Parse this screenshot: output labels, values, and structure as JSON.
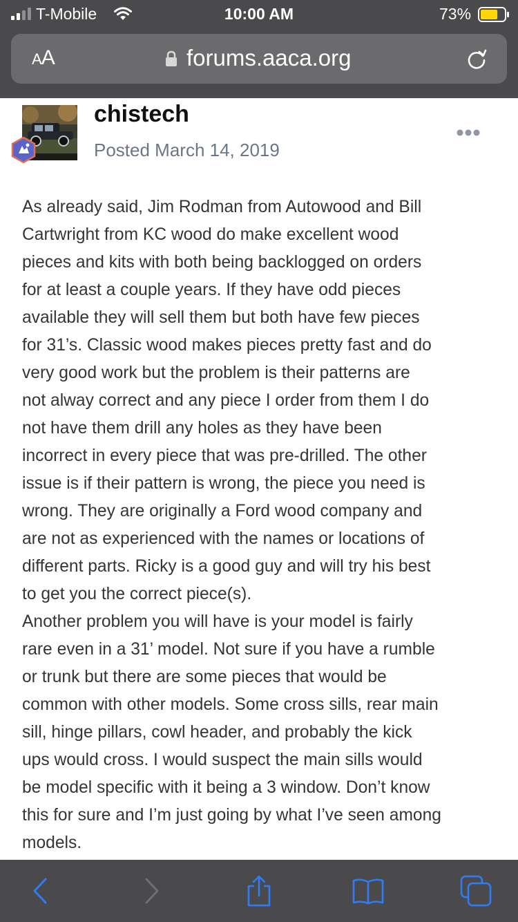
{
  "status_bar": {
    "carrier": "T-Mobile",
    "time": "10:00 AM",
    "battery_percent": "73%",
    "battery_level": 0.73
  },
  "browser": {
    "text_size_label_small": "A",
    "text_size_label_large": "A",
    "url": "forums.aaca.org"
  },
  "post": {
    "author": "chistech",
    "posted": "Posted March 14, 2019",
    "lines": [
      "As already said, Jim Rodman from Autowood and Bill",
      "Cartwright from KC wood do make excellent wood",
      "pieces and kits with both being backlogged on orders",
      "for at least a couple years. If they have odd pieces",
      "available they will sell them but both have few pieces",
      "for 31’s. Classic wood makes pieces pretty fast and do",
      "very good work but the problem is their patterns are",
      "not alway correct and any piece I order from them I do",
      "not have them drill any holes as they have been",
      "incorrect in every piece that was pre-drilled. The other",
      "issue is if their pattern is wrong, the piece you need is",
      "wrong. They are originally a Ford wood company and",
      "are not as experienced with the names or locations of",
      "different parts. Ricky is a good guy and will try his best",
      "to get you the correct piece(s).",
      "     Another problem you will have is your model is fairly",
      "rare even in a 31’ model. Not sure if you have a rumble",
      "or trunk but there are some pieces that would be",
      "common with other models. Some cross sills, rear main",
      "sill, hinge pillars, cowl header, and probably the kick",
      "ups would cross. I would suspect the main sills would",
      "be model specific with it being a 3 window. Don’t know",
      "this for sure and I’m just going by what I’ve seen among",
      "models."
    ]
  },
  "toolbar": {
    "icons": [
      "back-icon",
      "forward-icon",
      "share-icon",
      "bookmarks-icon",
      "tabs-icon"
    ],
    "accent": "#2f7cf6"
  }
}
